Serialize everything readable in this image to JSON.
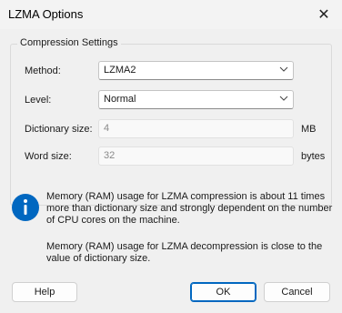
{
  "window": {
    "title": "LZMA Options",
    "close_glyph": "✕"
  },
  "group": {
    "legend": "Compression Settings",
    "method": {
      "label": "Method:",
      "value": "LZMA2"
    },
    "level": {
      "label": "Level:",
      "value": "Normal"
    },
    "dictionary": {
      "label": "Dictionary size:",
      "value": "4",
      "unit": "MB"
    },
    "word": {
      "label": "Word size:",
      "value": "32",
      "unit": "bytes"
    }
  },
  "info": {
    "icon": "info-icon",
    "paragraph1_line1": "Memory (RAM) usage for LZMA compression is about 11 times",
    "paragraph1_line2": "more than dictionary size and strongly dependent on the number",
    "paragraph1_line3": "of CPU cores on the machine.",
    "paragraph2_line1": "Memory (RAM) usage for LZMA decompression is close to the",
    "paragraph2_line2": "value of dictionary size."
  },
  "buttons": {
    "help": "Help",
    "ok": "OK",
    "cancel": "Cancel"
  },
  "colors": {
    "accent": "#0067c0",
    "info_icon": "#0067c0"
  }
}
